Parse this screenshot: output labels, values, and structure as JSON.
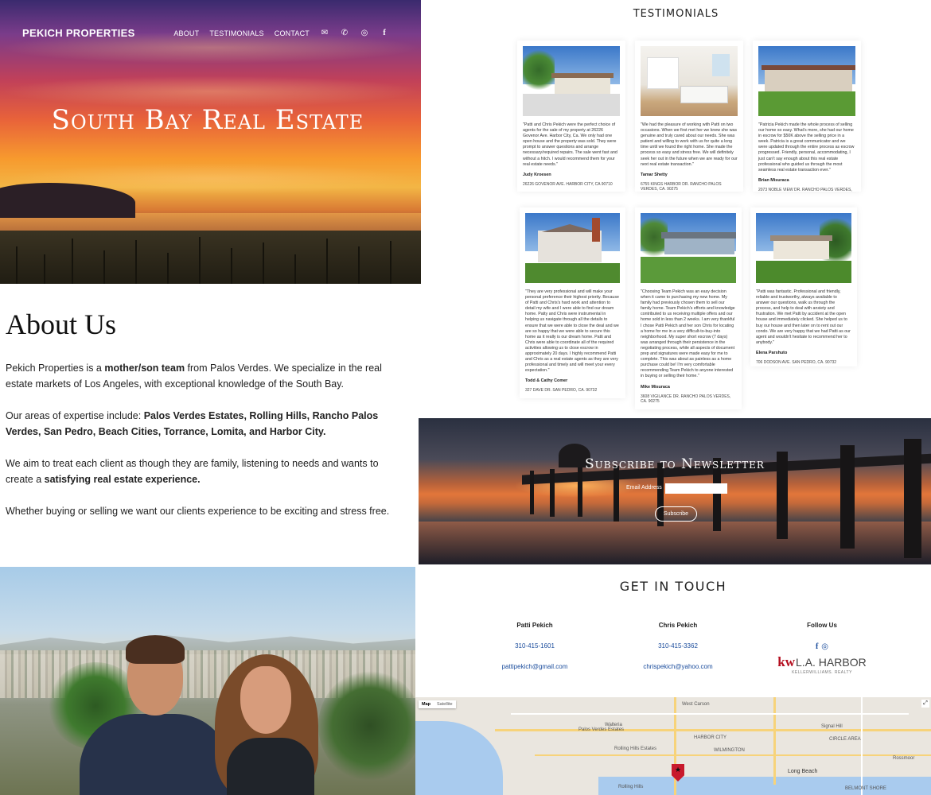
{
  "header": {
    "brand": "PEKICH PROPERTIES",
    "nav": [
      "ABOUT",
      "TESTIMONIALS",
      "CONTACT"
    ],
    "icons": [
      "envelope-icon",
      "phone-icon",
      "instagram-icon",
      "facebook-icon"
    ],
    "hero_title": "South Bay Real Estate"
  },
  "about": {
    "title": "About Us",
    "p1_a": "Pekich Properties is a ",
    "p1_b": "mother/son team",
    "p1_c": " from Palos Verdes. We specialize in the real estate markets of Los Angeles, with exceptional knowledge of the South Bay.",
    "p2_a": "Our areas of expertise include: ",
    "p2_b": "Palos Verdes Estates, Rolling Hills, Rancho Palos Verdes, San Pedro, Beach Cities, Torrance, Lomita, and Harbor City.",
    "p3_a": "We aim to treat each client as though they are family, listening to needs and wants to create a ",
    "p3_b": "satisfying real estate experience.",
    "p4": "Whether buying or selling we want our clients experience to be exciting and stress free."
  },
  "testimonials": {
    "title": "TESTIMONIALS",
    "cards": [
      {
        "quote": "\"Patti and Chris Pekich were the perfect choice of agents for the sale of my property at 26226 Govenor Ave. Harbor City, Ca. We only had one open house and the property was sold. They were prompt to answer questions and arrange necessary/required repairs. The sale went fast and without a hitch. I would recommend them for your real estate needs.\"",
        "name": "Judy Kroesen",
        "address": "26226 GOVENOR AVE. HARBOR CITY, CA 90710"
      },
      {
        "quote": "\"We had the pleasure of working with Patti on two occasions. When we first met her we knew she was genuine and truly cared about our needs. She was patient and willing to work with us for quite a long time until we found the right home. She made the process so easy and stress free. We will definitely seek her out in the future when we are ready for our next real estate transaction.\"",
        "name": "Tamar Shetty",
        "address": "6755 KINGS HARBOR DR. RANCHO PALOS VERDES, CA. 90275"
      },
      {
        "quote": "\"Patricia Pekich made the whole process of selling our home so easy. What's more, she had our home in escrow for $50K above the selling price in a week. Patricia is a great communicator and we were updated through the entire process as escrow progressed. Friendly, personal, accommodating, I just can't say enough about this real estate professional who guided us through the most seamless real estate transaction ever.\"",
        "name": "Brian Misuraca",
        "address": "2073 NOBLE VIEW DR. RANCHO PALOS VERDES,"
      },
      {
        "quote": "\"They are very professional and will make your personal preference their highest priority. Because of Patti and Chris's hard work and attention to detail my wife and I were able to find our dream home. Patty and Chris were instrumental in helping us navigate through all the details to ensure that we were able to close the deal and we are so happy that we were able to secure this home as it really is our dream home. Patti and Chris were able to coordinate all of the required activities allowing us to close escrow in approximately 20 days. I highly recommend Patti and Chris as a real estate agents as they are very professional and timely and will meet your every expectation.\"",
        "name": "Todd & Cathy Comer",
        "address": "327 DAVE DR. SAN PEDRO, CA. 90732"
      },
      {
        "quote": "\"Choosing Team Pekich was an easy decision when it came to purchasing my new home. My family had previously chosen them to sell our family home. Team Pekich's efforts and knowledge contributed to us receiving multiple offers and our home sold in less than 2 weeks. I am very thankful I chose Patti Pekich and her son Chris for locating a home for me in a very difficult-to-buy-into neighborhood. My super short escrow (7 days) was arranged through their persistence in the negotiating process, while all aspects of document prep and signatures were made easy for me to complete. This was about as painless as a home purchase could be! I'm very comfortable recommending Team Pekich to anyone interested in buying or selling their home.\"",
        "name": "Mike Misuraca",
        "address": "3608 VIGILANCE DR. RANCHO PALOS VERDES, CA. 90275"
      },
      {
        "quote": "\"Patti was fantastic. Professional and friendly, reliable and trustworthy, always available to answer our questions, walk us through the process, and help to deal with anxiety and frustration. We met Patti by accident at the open house and immediately clicked. She helped us to buy our house and then later on to rent out our condo. We are very happy that we had Patti as our agent and wouldn't hesitate to recommend her to anybody.\"",
        "name": "Elena Parshuto",
        "address": "706 DODSON AVE. SAN PEDRO, CA. 90732"
      }
    ]
  },
  "newsletter": {
    "title": "Subscribe to Newsletter",
    "email_label": "Email Address",
    "email_value": "",
    "button": "Subscribe"
  },
  "contact": {
    "title": "GET IN TOUCH",
    "agents": [
      {
        "name": "Patti Pekich",
        "phone": "310-415-1601",
        "email": "pattipekich@gmail.com"
      },
      {
        "name": "Chris Pekich",
        "phone": "310-415-3362",
        "email": "chrispekich@yahoo.com"
      }
    ],
    "follow": "Follow Us",
    "follow_icons": [
      "facebook-icon",
      "instagram-icon"
    ],
    "logo_mark": "kw",
    "logo_text": "L.A. HARBOR",
    "logo_sub": "KELLERWILLIAMS. REALTY",
    "brand_color": "#b40d1e",
    "link_color": "#1a4c9c"
  },
  "map": {
    "tabs": [
      "Map",
      "Satellite"
    ],
    "active_tab": "Map",
    "labels": [
      "West Carson",
      "Walteria",
      "Palos Verdes Estates",
      "Rolling Hills Estates",
      "Signal Hill",
      "Long Beach",
      "Rolling Hills",
      "HARBOR CITY",
      "WILMINGTON",
      "Rossmoor",
      "CIRCLE AREA",
      "BELMONT SHORE"
    ]
  }
}
